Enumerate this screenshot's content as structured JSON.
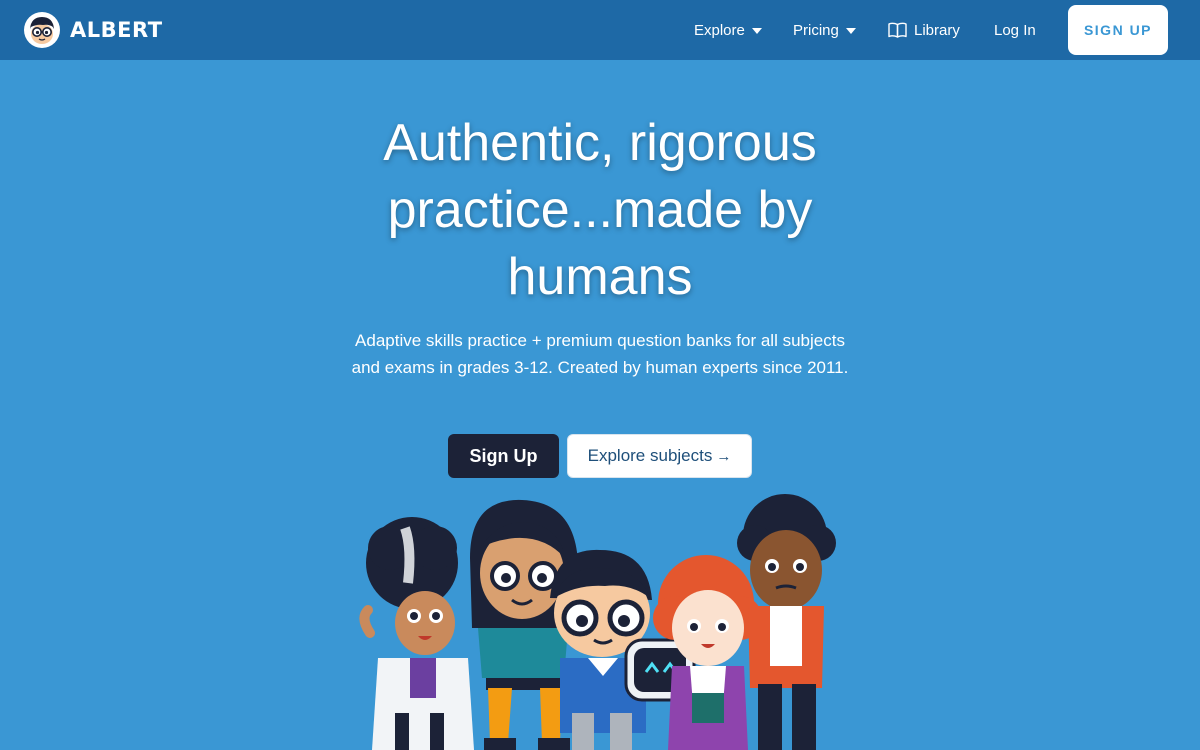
{
  "brand": {
    "name": "ALBERT",
    "logo_icon": "albert-mascot-icon"
  },
  "nav": {
    "explore": "Explore",
    "pricing": "Pricing",
    "library": "Library",
    "login": "Log In",
    "signup": "SIGN UP"
  },
  "hero": {
    "title": "Authentic, rigorous practice...made by humans",
    "subtitle": "Adaptive skills practice + premium question banks for all subjects and exams in grades 3-12. Created by human experts since 2011.",
    "primary_cta": "Sign Up",
    "secondary_cta": "Explore subjects",
    "secondary_arrow": "→"
  },
  "colors": {
    "nav_bg": "#1e69a6",
    "hero_bg": "#3a97d4",
    "dark_button": "#1c2237",
    "signup_text": "#3a97d4"
  }
}
